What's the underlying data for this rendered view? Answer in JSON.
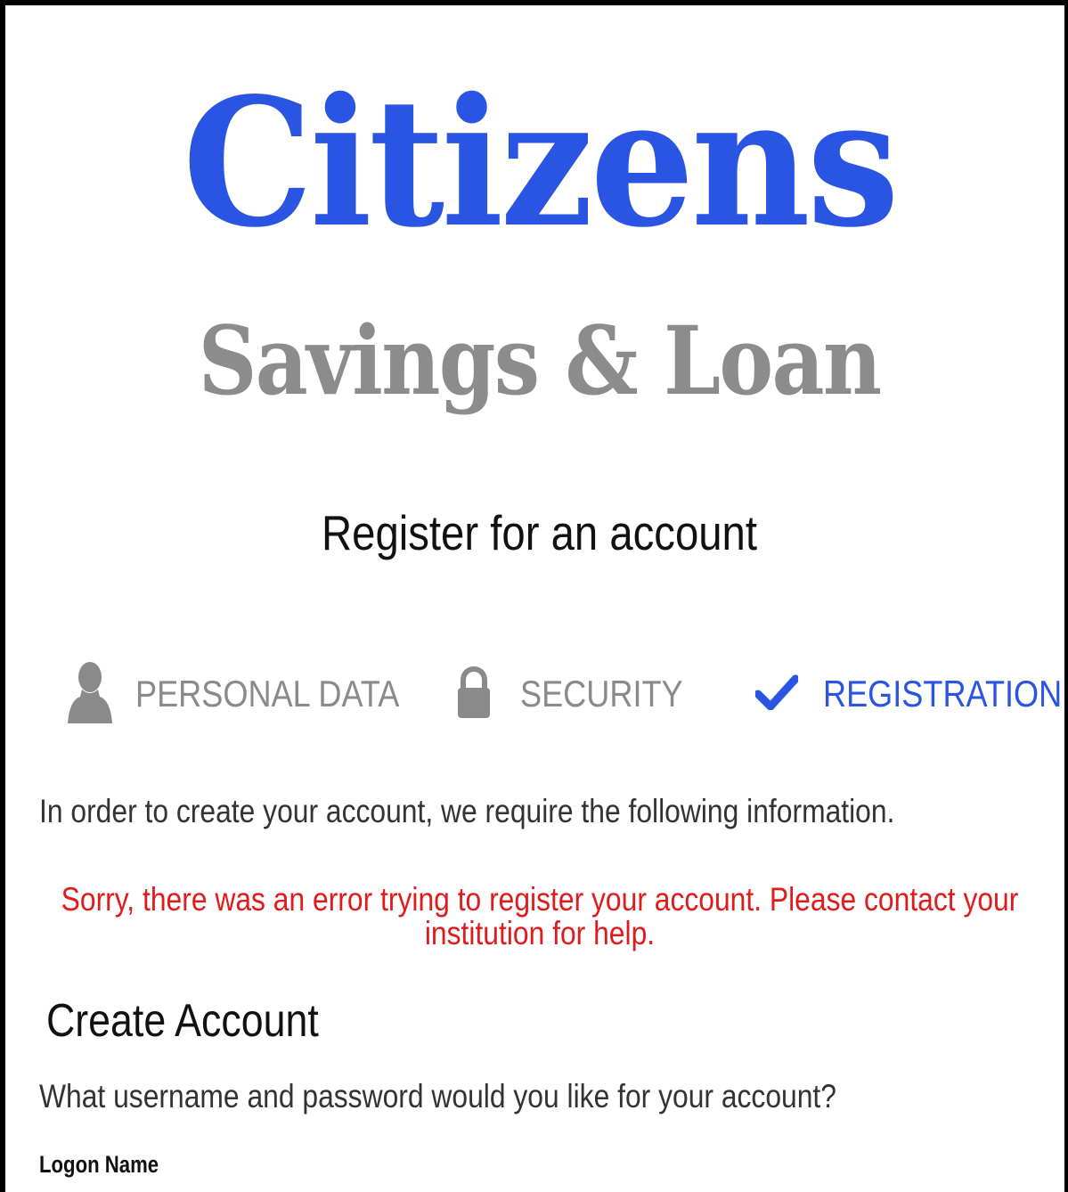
{
  "logo": {
    "line1": "Citizens",
    "line2": "Savings & Loan",
    "colors": {
      "line1": "#2a55e3",
      "line2": "#8c8c8c"
    }
  },
  "page_title": "Register for an account",
  "steps": [
    {
      "label": "PERSONAL DATA",
      "icon": "person-icon",
      "state": "inactive"
    },
    {
      "label": "SECURITY",
      "icon": "lock-icon",
      "state": "inactive"
    },
    {
      "label": "REGISTRATION",
      "icon": "checkmark-icon",
      "state": "active"
    }
  ],
  "colors": {
    "accent": "#2a55e3",
    "inactive_step": "#8a8a8a",
    "error": "#e01b1b"
  },
  "intro_text": "In order to create your account, we require the following information.",
  "error_message": "Sorry, there was an error trying to register your account. Please contact your institution for help.",
  "create_account": {
    "title": "Create Account",
    "question": "What username and password would you like for your account?",
    "logon_name_label": "Logon Name"
  }
}
